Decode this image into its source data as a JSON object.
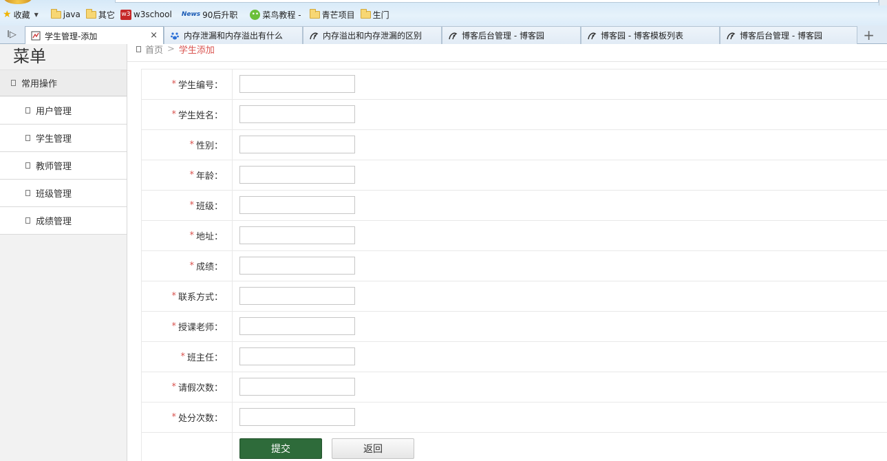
{
  "browser": {
    "bookmarks": [
      {
        "label": "收藏",
        "icon": "star-icon"
      },
      {
        "label": "java",
        "icon": "folder-icon"
      },
      {
        "label": "其它",
        "icon": "folder-icon"
      },
      {
        "label": "w3school",
        "icon": "w3school-icon"
      },
      {
        "label": "90后升职",
        "icon": "news-icon"
      },
      {
        "label": "菜鸟教程 -",
        "icon": "runoob-icon"
      },
      {
        "label": "青芒项目",
        "icon": "folder-icon"
      },
      {
        "label": "生门",
        "icon": "folder-icon"
      }
    ],
    "w3_badge": "w3",
    "news_badge": "News",
    "tabs": [
      {
        "title": "学生管理-添加",
        "active": true
      },
      {
        "title": "内存泄漏和内存溢出有什么",
        "active": false
      },
      {
        "title": "内存溢出和内存泄漏的区别",
        "active": false
      },
      {
        "title": "博客后台管理 - 博客园",
        "active": false
      },
      {
        "title": "博客园 - 博客模板列表",
        "active": false
      },
      {
        "title": "博客后台管理 - 博客园",
        "active": false
      }
    ],
    "tab_close": "×",
    "tab_add": "+",
    "sidebar_toggle": "I▷"
  },
  "sidebar": {
    "title": "菜单",
    "group": "常用操作",
    "items": [
      "用户管理",
      "学生管理",
      "教师管理",
      "班级管理",
      "成绩管理"
    ]
  },
  "breadcrumb": {
    "home": "首页",
    "separator": ">",
    "current": "学生添加"
  },
  "form": {
    "required_mark": "*",
    "fields": [
      {
        "label": "学生编号：",
        "value": ""
      },
      {
        "label": "学生姓名：",
        "value": ""
      },
      {
        "label": "性别：",
        "value": ""
      },
      {
        "label": "年龄：",
        "value": ""
      },
      {
        "label": "班级：",
        "value": ""
      },
      {
        "label": "地址：",
        "value": ""
      },
      {
        "label": "成绩：",
        "value": ""
      },
      {
        "label": "联系方式：",
        "value": ""
      },
      {
        "label": "授课老师：",
        "value": ""
      },
      {
        "label": "班主任：",
        "value": ""
      },
      {
        "label": "请假次数：",
        "value": ""
      },
      {
        "label": "处分次数：",
        "value": ""
      }
    ],
    "submit_label": "提交",
    "back_label": "返回"
  },
  "colors": {
    "submit_bg": "#2e6b3a",
    "required": "#d9534f",
    "chrome_bg": "#d6e9f8"
  }
}
